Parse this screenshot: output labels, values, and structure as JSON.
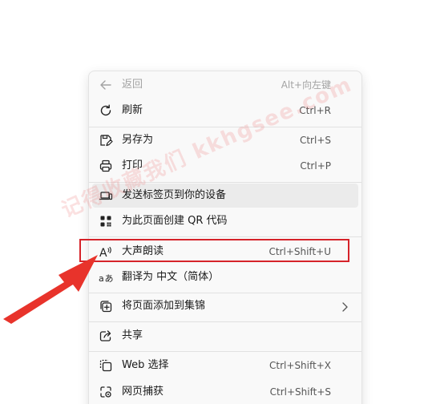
{
  "menu": {
    "items": [
      {
        "id": "back",
        "label": "返回",
        "shortcut": "Alt+向左键",
        "icon": "arrow-left-icon"
      },
      {
        "id": "refresh",
        "label": "刷新",
        "shortcut": "Ctrl+R",
        "icon": "refresh-icon"
      },
      {
        "id": "save-as",
        "label": "另存为",
        "shortcut": "Ctrl+S",
        "icon": "save-as-icon"
      },
      {
        "id": "print",
        "label": "打印",
        "shortcut": "Ctrl+P",
        "icon": "printer-icon"
      },
      {
        "id": "send-tab",
        "label": "发送标签页到你的设备",
        "shortcut": "",
        "icon": "devices-icon"
      },
      {
        "id": "qr-code",
        "label": "为此页面创建 QR 代码",
        "shortcut": "",
        "icon": "qr-code-icon"
      },
      {
        "id": "read-aloud",
        "label": "大声朗读",
        "shortcut": "Ctrl+Shift+U",
        "icon": "read-aloud-icon"
      },
      {
        "id": "translate",
        "label": "翻译为 中文（简体）",
        "shortcut": "",
        "icon": "translate-icon"
      },
      {
        "id": "add-collection",
        "label": "将页面添加到集锦",
        "shortcut": "",
        "icon": "collections-icon"
      },
      {
        "id": "share",
        "label": "共享",
        "shortcut": "",
        "icon": "share-icon"
      },
      {
        "id": "web-select",
        "label": "Web 选择",
        "shortcut": "Ctrl+Shift+X",
        "icon": "web-select-icon"
      },
      {
        "id": "web-capture",
        "label": "网页捕获",
        "shortcut": "Ctrl+Shift+S",
        "icon": "web-capture-icon"
      }
    ]
  },
  "watermark": {
    "text": "记得收藏我们 kkhgsee.com"
  },
  "colors": {
    "menu_bg": "#f9f9f9",
    "hover_bg": "#ebebeb",
    "highlight": "#d6232a",
    "arrow": "#e8332b"
  }
}
